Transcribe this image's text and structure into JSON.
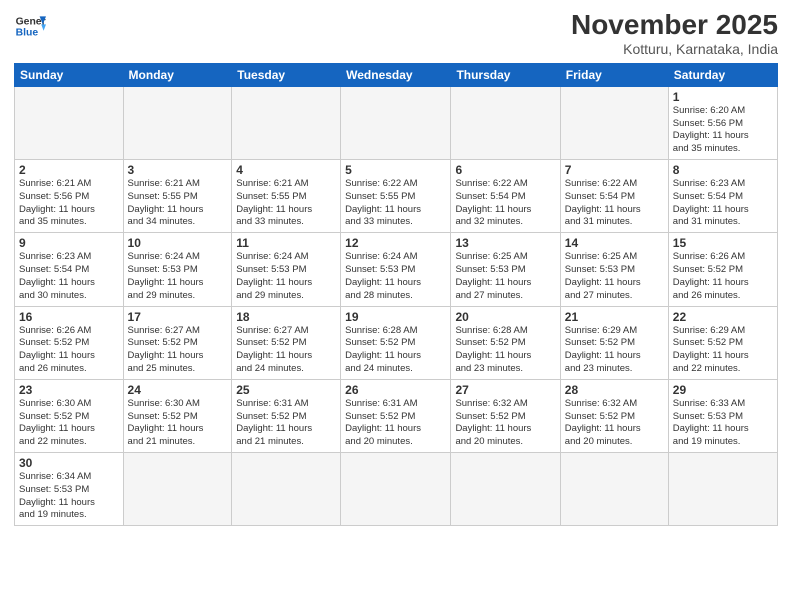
{
  "header": {
    "logo_general": "General",
    "logo_blue": "Blue",
    "month_title": "November 2025",
    "location": "Kotturu, Karnataka, India"
  },
  "weekdays": [
    "Sunday",
    "Monday",
    "Tuesday",
    "Wednesday",
    "Thursday",
    "Friday",
    "Saturday"
  ],
  "weeks": [
    [
      {
        "day": "",
        "info": ""
      },
      {
        "day": "",
        "info": ""
      },
      {
        "day": "",
        "info": ""
      },
      {
        "day": "",
        "info": ""
      },
      {
        "day": "",
        "info": ""
      },
      {
        "day": "",
        "info": ""
      },
      {
        "day": "1",
        "info": "Sunrise: 6:20 AM\nSunset: 5:56 PM\nDaylight: 11 hours\nand 35 minutes."
      }
    ],
    [
      {
        "day": "2",
        "info": "Sunrise: 6:21 AM\nSunset: 5:56 PM\nDaylight: 11 hours\nand 35 minutes."
      },
      {
        "day": "3",
        "info": "Sunrise: 6:21 AM\nSunset: 5:55 PM\nDaylight: 11 hours\nand 34 minutes."
      },
      {
        "day": "4",
        "info": "Sunrise: 6:21 AM\nSunset: 5:55 PM\nDaylight: 11 hours\nand 33 minutes."
      },
      {
        "day": "5",
        "info": "Sunrise: 6:22 AM\nSunset: 5:55 PM\nDaylight: 11 hours\nand 33 minutes."
      },
      {
        "day": "6",
        "info": "Sunrise: 6:22 AM\nSunset: 5:54 PM\nDaylight: 11 hours\nand 32 minutes."
      },
      {
        "day": "7",
        "info": "Sunrise: 6:22 AM\nSunset: 5:54 PM\nDaylight: 11 hours\nand 31 minutes."
      },
      {
        "day": "8",
        "info": "Sunrise: 6:23 AM\nSunset: 5:54 PM\nDaylight: 11 hours\nand 31 minutes."
      }
    ],
    [
      {
        "day": "9",
        "info": "Sunrise: 6:23 AM\nSunset: 5:54 PM\nDaylight: 11 hours\nand 30 minutes."
      },
      {
        "day": "10",
        "info": "Sunrise: 6:24 AM\nSunset: 5:53 PM\nDaylight: 11 hours\nand 29 minutes."
      },
      {
        "day": "11",
        "info": "Sunrise: 6:24 AM\nSunset: 5:53 PM\nDaylight: 11 hours\nand 29 minutes."
      },
      {
        "day": "12",
        "info": "Sunrise: 6:24 AM\nSunset: 5:53 PM\nDaylight: 11 hours\nand 28 minutes."
      },
      {
        "day": "13",
        "info": "Sunrise: 6:25 AM\nSunset: 5:53 PM\nDaylight: 11 hours\nand 27 minutes."
      },
      {
        "day": "14",
        "info": "Sunrise: 6:25 AM\nSunset: 5:53 PM\nDaylight: 11 hours\nand 27 minutes."
      },
      {
        "day": "15",
        "info": "Sunrise: 6:26 AM\nSunset: 5:52 PM\nDaylight: 11 hours\nand 26 minutes."
      }
    ],
    [
      {
        "day": "16",
        "info": "Sunrise: 6:26 AM\nSunset: 5:52 PM\nDaylight: 11 hours\nand 26 minutes."
      },
      {
        "day": "17",
        "info": "Sunrise: 6:27 AM\nSunset: 5:52 PM\nDaylight: 11 hours\nand 25 minutes."
      },
      {
        "day": "18",
        "info": "Sunrise: 6:27 AM\nSunset: 5:52 PM\nDaylight: 11 hours\nand 24 minutes."
      },
      {
        "day": "19",
        "info": "Sunrise: 6:28 AM\nSunset: 5:52 PM\nDaylight: 11 hours\nand 24 minutes."
      },
      {
        "day": "20",
        "info": "Sunrise: 6:28 AM\nSunset: 5:52 PM\nDaylight: 11 hours\nand 23 minutes."
      },
      {
        "day": "21",
        "info": "Sunrise: 6:29 AM\nSunset: 5:52 PM\nDaylight: 11 hours\nand 23 minutes."
      },
      {
        "day": "22",
        "info": "Sunrise: 6:29 AM\nSunset: 5:52 PM\nDaylight: 11 hours\nand 22 minutes."
      }
    ],
    [
      {
        "day": "23",
        "info": "Sunrise: 6:30 AM\nSunset: 5:52 PM\nDaylight: 11 hours\nand 22 minutes."
      },
      {
        "day": "24",
        "info": "Sunrise: 6:30 AM\nSunset: 5:52 PM\nDaylight: 11 hours\nand 21 minutes."
      },
      {
        "day": "25",
        "info": "Sunrise: 6:31 AM\nSunset: 5:52 PM\nDaylight: 11 hours\nand 21 minutes."
      },
      {
        "day": "26",
        "info": "Sunrise: 6:31 AM\nSunset: 5:52 PM\nDaylight: 11 hours\nand 20 minutes."
      },
      {
        "day": "27",
        "info": "Sunrise: 6:32 AM\nSunset: 5:52 PM\nDaylight: 11 hours\nand 20 minutes."
      },
      {
        "day": "28",
        "info": "Sunrise: 6:32 AM\nSunset: 5:52 PM\nDaylight: 11 hours\nand 20 minutes."
      },
      {
        "day": "29",
        "info": "Sunrise: 6:33 AM\nSunset: 5:53 PM\nDaylight: 11 hours\nand 19 minutes."
      }
    ],
    [
      {
        "day": "30",
        "info": "Sunrise: 6:34 AM\nSunset: 5:53 PM\nDaylight: 11 hours\nand 19 minutes."
      },
      {
        "day": "",
        "info": ""
      },
      {
        "day": "",
        "info": ""
      },
      {
        "day": "",
        "info": ""
      },
      {
        "day": "",
        "info": ""
      },
      {
        "day": "",
        "info": ""
      },
      {
        "day": "",
        "info": ""
      }
    ]
  ]
}
